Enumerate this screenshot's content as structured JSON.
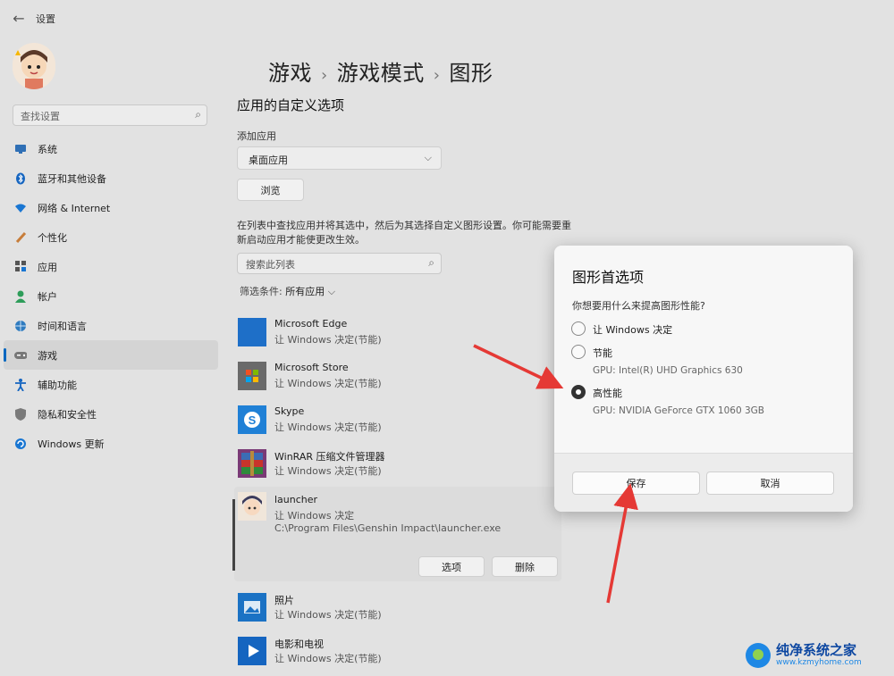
{
  "window": {
    "title": "设置"
  },
  "search": {
    "placeholder": "查找设置"
  },
  "sidebar": {
    "items": [
      {
        "label": "系统",
        "icon": "monitor-icon"
      },
      {
        "label": "蓝牙和其他设备",
        "icon": "bluetooth-icon"
      },
      {
        "label": "网络 & Internet",
        "icon": "wifi-icon"
      },
      {
        "label": "个性化",
        "icon": "brush-icon"
      },
      {
        "label": "应用",
        "icon": "apps-icon"
      },
      {
        "label": "帐户",
        "icon": "person-icon"
      },
      {
        "label": "时间和语言",
        "icon": "globe-clock-icon"
      },
      {
        "label": "游戏",
        "icon": "gamepad-icon",
        "active": true
      },
      {
        "label": "辅助功能",
        "icon": "accessibility-icon"
      },
      {
        "label": "隐私和安全性",
        "icon": "shield-icon"
      },
      {
        "label": "Windows 更新",
        "icon": "update-icon"
      }
    ]
  },
  "breadcrumb": {
    "part1": "游戏",
    "part2": "游戏模式",
    "part3": "图形",
    "separator": "›"
  },
  "main": {
    "section_title": "应用的自定义选项",
    "add_app_label": "添加应用",
    "app_type_value": "桌面应用",
    "browse_label": "浏览",
    "description": "在列表中查找应用并将其选中，然后为其选择自定义图形设置。你可能需要重新启动应用才能使更改生效。",
    "list_search_placeholder": "搜索此列表",
    "filter_label": "筛选条件:",
    "filter_value": "所有应用",
    "apps": [
      {
        "name": "Microsoft Edge",
        "sub": "让 Windows 决定(节能)",
        "icon": "edge-icon"
      },
      {
        "name": "Microsoft Store",
        "sub": "让 Windows 决定(节能)",
        "icon": "store-icon"
      },
      {
        "name": "Skype",
        "sub": "让 Windows 决定(节能)",
        "icon": "skype-icon"
      },
      {
        "name": "WinRAR 压缩文件管理器",
        "sub": "让 Windows 决定(节能)",
        "icon": "winrar-icon"
      }
    ],
    "expanded_app": {
      "name": "launcher",
      "sub": "让 Windows 决定",
      "path": "C:\\Program Files\\Genshin Impact\\launcher.exe",
      "options_label": "选项",
      "delete_label": "删除"
    },
    "apps_after": [
      {
        "name": "照片",
        "sub": "让 Windows 决定(节能)",
        "icon": "photos-icon"
      },
      {
        "name": "电影和电视",
        "sub": "让 Windows 决定(节能)",
        "icon": "movies-icon"
      }
    ]
  },
  "dialog": {
    "title": "图形首选项",
    "question": "你想要用什么来提高图形性能?",
    "options": [
      {
        "label": "让 Windows 决定",
        "gpu": "",
        "selected": false
      },
      {
        "label": "节能",
        "gpu": "GPU: Intel(R) UHD Graphics 630",
        "selected": false
      },
      {
        "label": "高性能",
        "gpu": "GPU: NVIDIA GeForce GTX 1060 3GB",
        "selected": true
      }
    ],
    "save_label": "保存",
    "cancel_label": "取消"
  },
  "watermark": {
    "line1": "纯净系统之家",
    "line2": "www.kzmyhome.com"
  },
  "colors": {
    "accent": "#0067c0",
    "arrow": "#e53935",
    "background": "#e2e2e2"
  }
}
